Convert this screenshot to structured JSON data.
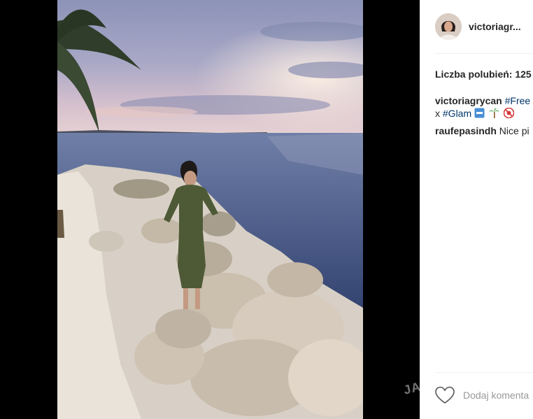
{
  "post": {
    "username": "victoriagr...",
    "likes_text": "Liczba polubień: 125",
    "caption_author": "victoriagrycan",
    "caption_text_1": "#Free",
    "caption_text_2": "x",
    "caption_tag_2": "#Glam",
    "comments": [
      {
        "author": "raufepasindh",
        "text": "Nice pi"
      }
    ],
    "add_comment_placeholder": "Dodaj komenta",
    "watermark": "JA"
  },
  "icons": {
    "like": "heart-icon",
    "avatar": "avatar",
    "emoji_1": "free-emoji-icon",
    "emoji_2": "palm-tree-emoji-icon",
    "emoji_3": "no-under-18-emoji-icon"
  },
  "colors": {
    "link": "#003569",
    "text": "#262626",
    "muted": "#999999",
    "divider": "#efefef"
  }
}
